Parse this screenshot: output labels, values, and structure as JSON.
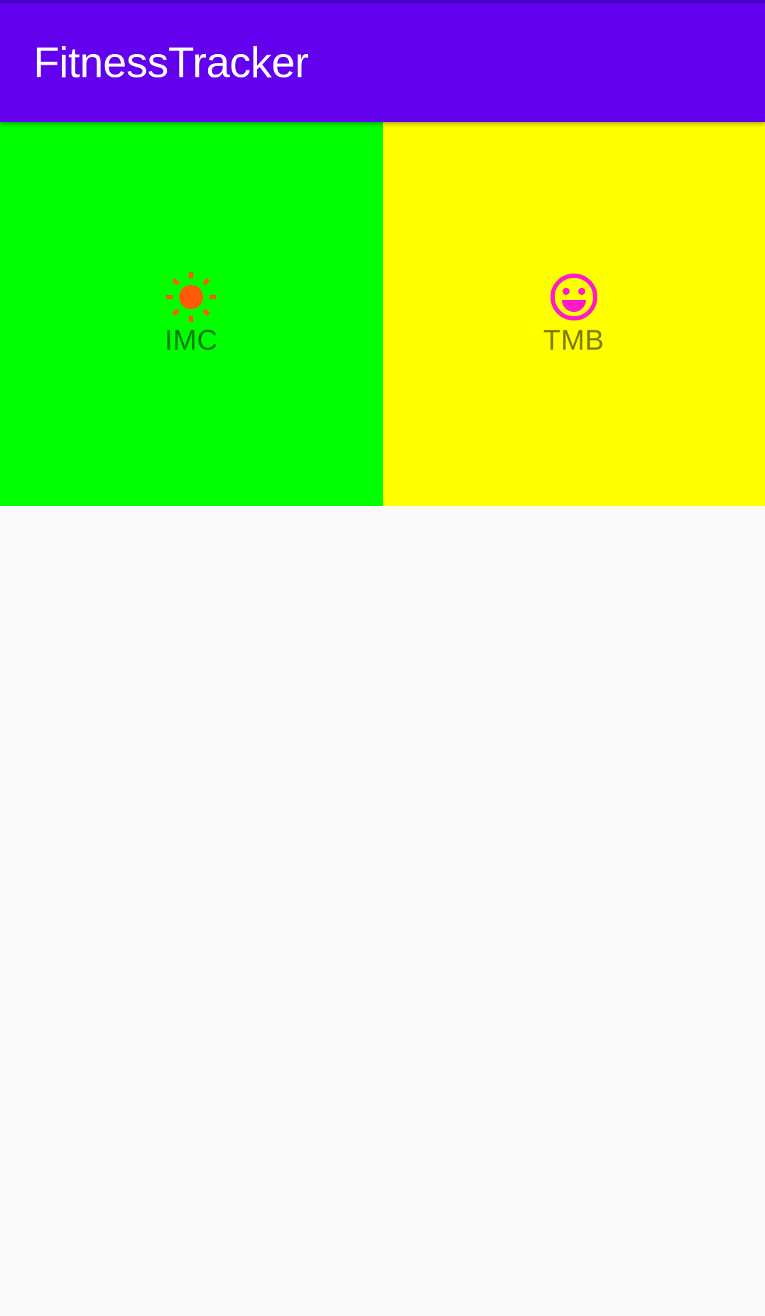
{
  "app_bar": {
    "title": "FitnessTracker",
    "color": "#6200ee"
  },
  "tiles": [
    {
      "label": "IMC",
      "icon": "sun-icon",
      "background": "#00ff00",
      "text_color": "#0a7a0a",
      "icon_color": "#ff5a0a"
    },
    {
      "label": "TMB",
      "icon": "smiley-face-icon",
      "background": "#ffff00",
      "text_color": "#7a7a00",
      "icon_color": "#ff1aca"
    }
  ]
}
